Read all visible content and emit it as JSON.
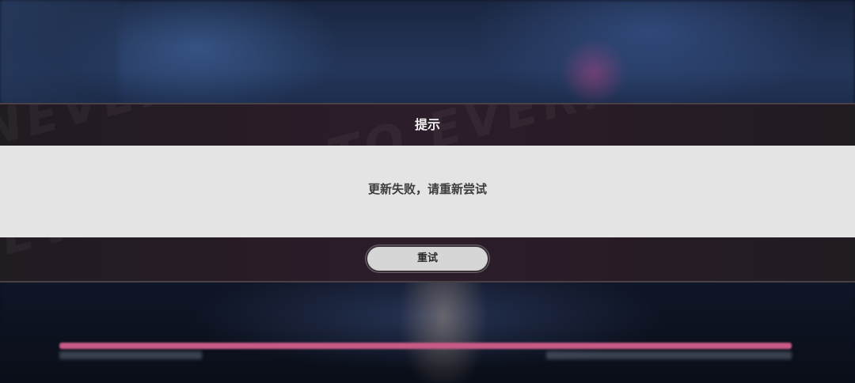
{
  "dialog": {
    "title": "提示",
    "message": "更新失败，请重新尝试",
    "retry_label": "重试",
    "watermark": "NEVERNESS TO EVERNESS NEVERNESS TO EVERNESS"
  },
  "loading": {
    "progress": 1.0
  },
  "colors": {
    "dialog_band": "#2c1d2a",
    "dialog_body": "#e4e4e4",
    "button": "#d6d6d6",
    "progress_fill": "#c85a86"
  }
}
